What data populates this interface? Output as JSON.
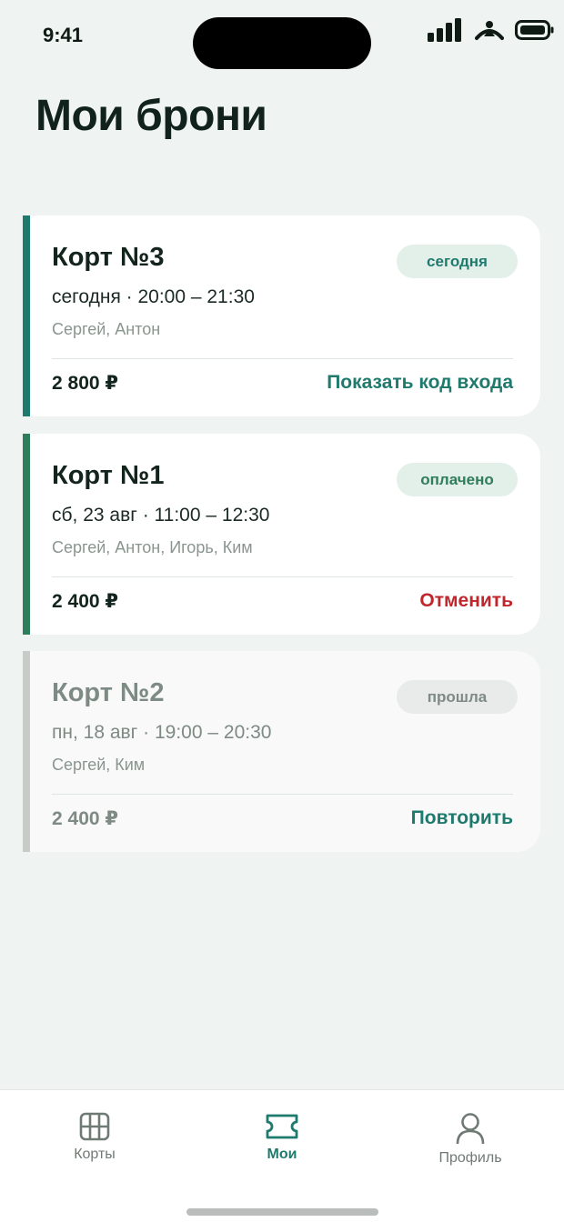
{
  "status": {
    "time": "9:41"
  },
  "page": {
    "title": "Мои брони"
  },
  "colors": {
    "accent": "#1f7a6e",
    "accent_paid": "#2e7d5b",
    "accent_past": "#c7ccc9",
    "danger": "#c0272d",
    "badge_active_bg": "#e3efe9",
    "badge_past_bg": "#e8ebea"
  },
  "bookings": [
    {
      "court": "Корт №3",
      "badge": "сегодня",
      "when": "сегодня · 20:00 – 21:30",
      "players": "Сергей, Антон",
      "price": "2 800 ₽",
      "action": "Показать код входа"
    },
    {
      "court": "Корт №1",
      "badge": "оплачено",
      "when": "сб, 23 авг · 11:00 – 12:30",
      "players": "Сергей, Антон, Игорь, Ким",
      "price": "2 400 ₽",
      "action": "Отменить"
    },
    {
      "court": "Корт №2",
      "badge": "прошла",
      "when": "пн, 18 авг · 19:00 – 20:30",
      "players": "Сергей, Ким",
      "price": "2 400 ₽",
      "action": "Повторить"
    }
  ],
  "tabs": [
    {
      "label": "Корты",
      "icon": "grid-icon"
    },
    {
      "label": "Мои",
      "icon": "ticket-icon",
      "active": true
    },
    {
      "label": "Профиль",
      "icon": "person-icon"
    }
  ]
}
